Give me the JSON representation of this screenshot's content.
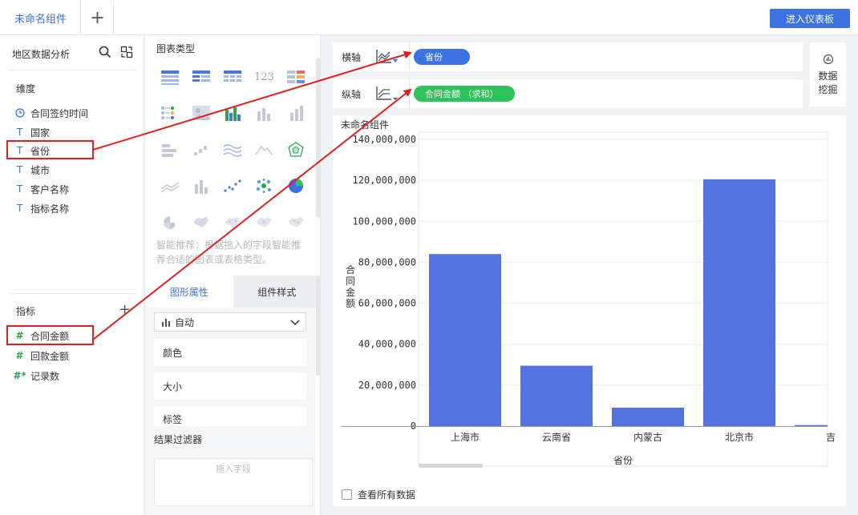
{
  "tabs": {
    "active": "未命名组件",
    "add_icon": "plus-icon"
  },
  "enter_dashboard": "进入仪表板",
  "dataset": {
    "title": "地区数据分析"
  },
  "dimensions": {
    "label": "维度",
    "items": [
      {
        "icon": "time",
        "label": "合同签约时间"
      },
      {
        "icon": "text",
        "label": "国家"
      },
      {
        "icon": "text",
        "label": "省份"
      },
      {
        "icon": "text",
        "label": "城市"
      },
      {
        "icon": "text",
        "label": "客户名称"
      },
      {
        "icon": "text",
        "label": "指标名称"
      }
    ]
  },
  "metrics": {
    "label": "指标",
    "items": [
      {
        "icon": "#",
        "label": "合同金额"
      },
      {
        "icon": "#",
        "label": "回款金额"
      },
      {
        "icon": "#*",
        "label": "记录数"
      }
    ]
  },
  "chart_types": {
    "title": "图表类型",
    "table_icon_text": "123",
    "smart_tip": "智能推荐：根据拖入的字段智能推荐合适的图表或表格类型。"
  },
  "props": {
    "tab_graph": "图形属性",
    "tab_style": "组件样式",
    "select_value": "自动",
    "rows": [
      "颜色",
      "大小",
      "标签"
    ]
  },
  "filter": {
    "title": "结果过滤器",
    "placeholder": "拖入字段"
  },
  "axes": {
    "x_label": "横轴",
    "x_field": "省份",
    "y_label": "纵轴",
    "y_field": "合同金额 （求和）"
  },
  "mining": {
    "line1": "数据",
    "line2": "挖掘"
  },
  "chart_card": {
    "title": "未命名组件",
    "show_all": "查看所有数据"
  },
  "colors": {
    "bar": "#5472e0",
    "accent": "#3d72e3",
    "green": "#2ec25b",
    "annotation": "#e02020"
  },
  "chart_data": {
    "type": "bar",
    "categories": [
      "上海市",
      "云南省",
      "内蒙古",
      "北京市",
      "吉林"
    ],
    "category_labels": [
      "上海市",
      "云南省",
      "内蒙古",
      "北京市",
      "吉"
    ],
    "values": [
      84000000,
      29500000,
      9000000,
      120500000,
      500000
    ],
    "ylim": [
      0,
      140000000
    ],
    "yticks": [
      "0",
      "20,000,000",
      "40,000,000",
      "60,000,000",
      "80,000,000",
      "100,000,000",
      "120,000,000",
      "140,000,000"
    ],
    "xlabel": "省份",
    "ylabel": "合同金额"
  }
}
